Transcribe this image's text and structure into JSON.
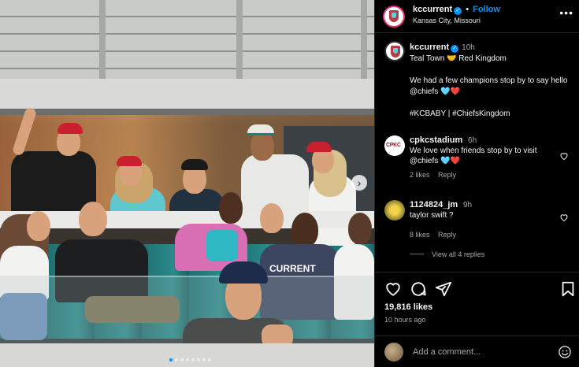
{
  "post": {
    "username": "kccurrent",
    "follow_label": "Follow",
    "location": "Kansas City, Missouri",
    "separator": "•",
    "more_label": "•••",
    "caption": {
      "time": "10h",
      "lines": [
        "Teal Town 🤝 Red Kingdom",
        "",
        "We had a few champions stop by to say hello @chiefs 🩵❤️",
        "",
        "#KCBABY | #ChiefsKingdom"
      ]
    }
  },
  "comments": [
    {
      "username": "cpkcstadium",
      "time": "6h",
      "text": "We love when friends stop by to visit @chiefs 🩵❤️",
      "likes": "2 likes",
      "reply": "Reply",
      "avatar_text": "CPKC",
      "avatar_color": "#ffffff"
    },
    {
      "username": "1124824_jm",
      "time": "9h",
      "text": "taylor swift ?",
      "likes": "8 likes",
      "reply": "Reply",
      "avatar_text": "",
      "avatar_color": "#e7c32a"
    }
  ],
  "view_replies": "View all 4 replies",
  "actions": {
    "likes": "19,816 likes",
    "ago": "10 hours ago",
    "icons": [
      "heart-icon",
      "comment-icon",
      "share-icon",
      "bookmark-icon"
    ]
  },
  "add_comment": {
    "placeholder": "Add a comment..."
  },
  "colors": {
    "accent": "#0095f6",
    "background": "#000000",
    "muted": "#a8a8a8",
    "kc_red": "#b83a44",
    "kc_teal": "#5fd0d6"
  }
}
